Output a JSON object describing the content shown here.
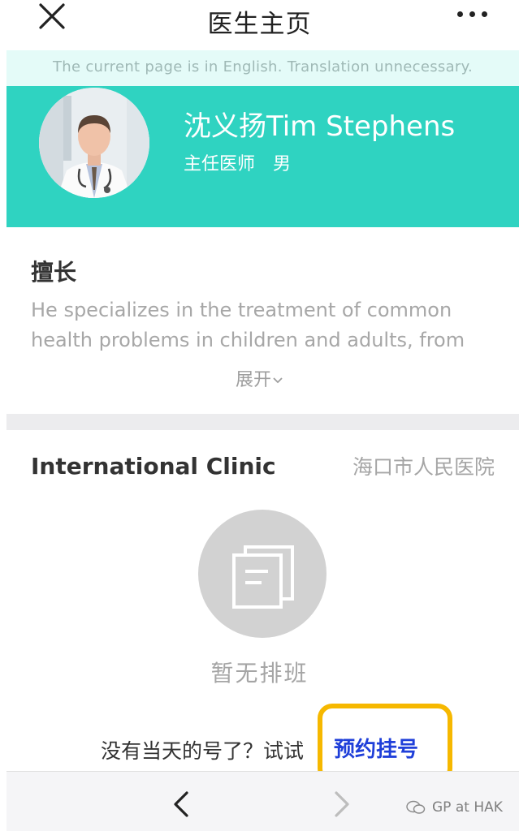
{
  "header": {
    "title": "医生主页",
    "close_icon": "close-icon",
    "more_icon": "more-icon"
  },
  "translation_bar": {
    "text": "The current page is in English. Translation unnecessary."
  },
  "doctor": {
    "name": "沈义扬Tim Stephens",
    "title": "主任医师",
    "gender": "男",
    "accent_color": "#2fd3c1"
  },
  "specialty": {
    "heading": "擅长",
    "text": "He specializes in the treatment of common health problems in children and adults, from",
    "expand_label": "展开",
    "expand_icon": "chevron-down-icon"
  },
  "clinic": {
    "name": "International Clinic",
    "hospital": "海口市人民医院",
    "empty_icon": "document-icon",
    "empty_text": "暂无排班",
    "prompt": "没有当天的号了？试试",
    "booking_label": "预约挂号",
    "highlight_color": "#f6b800",
    "link_color": "#1f3fd9"
  },
  "bottom_nav": {
    "back_icon": "chevron-left-icon",
    "forward_icon": "chevron-right-icon",
    "watermark": "GP at HAK"
  }
}
